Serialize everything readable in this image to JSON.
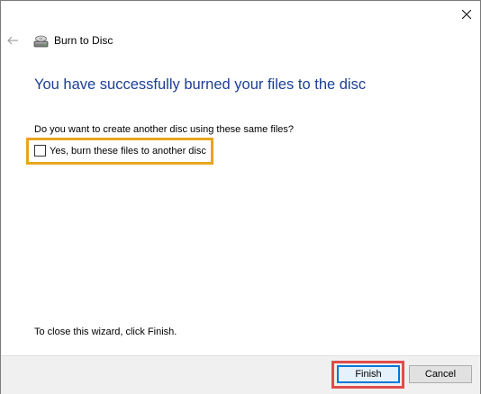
{
  "window": {
    "title": "Burn to Disc"
  },
  "icons": {
    "close": "close-icon",
    "back": "back-arrow-icon",
    "disc": "disc-drive-icon"
  },
  "main": {
    "heading": "You have successfully burned your files to the disc",
    "question": "Do you want to create another disc using these same files?",
    "checkbox_label": "Yes, burn these files to another disc",
    "checkbox_checked": false,
    "footer_hint": "To close this wizard, click Finish."
  },
  "buttons": {
    "finish": "Finish",
    "cancel": "Cancel"
  },
  "colors": {
    "heading": "#1c3f95",
    "checkbox_highlight": "#e8a51f",
    "finish_highlight": "#e04c4c",
    "default_button_border": "#0078d7"
  }
}
